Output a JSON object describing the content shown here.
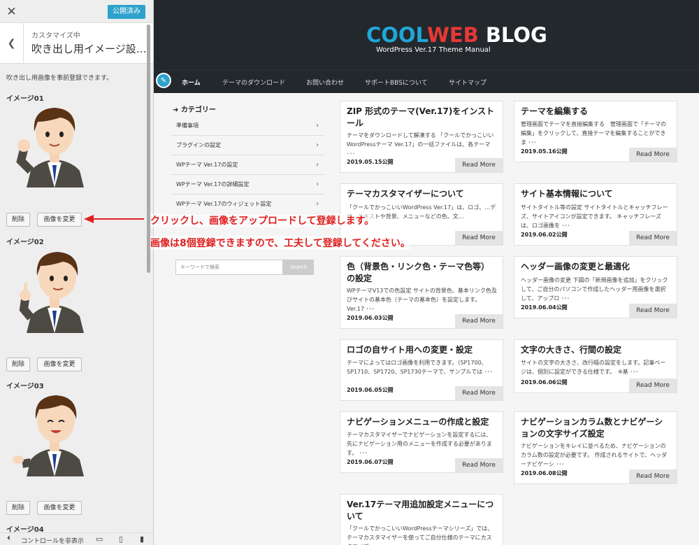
{
  "customizer": {
    "close_icon": "close-icon",
    "publish_label": "公開済み",
    "section_sub": "カスタマイズ中",
    "section_title": "吹き出し用イメージ設…",
    "description": "吹き出し用画像を事前登録できます。",
    "images": [
      {
        "label": "イメージ01",
        "delete": "削除",
        "change": "画像を変更"
      },
      {
        "label": "イメージ02",
        "delete": "削除",
        "change": "画像を変更"
      },
      {
        "label": "イメージ03",
        "delete": "削除",
        "change": "画像を変更"
      },
      {
        "label": "イメージ04"
      }
    ],
    "footer_label": "コントロールを非表示"
  },
  "site": {
    "logo_parts": [
      "COOL",
      "WEB",
      " BLOG"
    ],
    "tagline": "WordPress Ver.17 Theme Manual",
    "nav": [
      "ホーム",
      "テーマのダウンロード",
      "お問い合わせ",
      "サポートBBSについて",
      "サイトマップ"
    ],
    "category_title": "カテゴリー",
    "categories": [
      "準備事項",
      "プラグインの設定",
      "WPテーマ Ver.17の設定",
      "WPテーマ Ver.17の詳細設定",
      "WPテーマ Ver.17のウィジェット設定"
    ],
    "search_placeholder": "キーワードで検索",
    "search_button": "Search",
    "read_more": "Read More",
    "posts_left": [
      {
        "title": "ZIP 形式のテーマ(Ver.17)をインストール",
        "text": "テーマをダウンロードして解凍する 「クールでかっこいいWordPressテーマ Ver.17」の一括ファイルは、各テーマ ･･･",
        "date": "2019.05.15公開"
      },
      {
        "title": "テーマカスタマイザーについて",
        "text": "「クールでかっこいいWordPress Ver.17」は、ロゴ、…デザ…テキストや背景、メニューなどの色、文…",
        "date": ""
      },
      {
        "title": "色（背景色・リンク色・テーマ色等）の設定",
        "text": "WPテーマV13での色設定 サイトの背景色、基本リンク色及びサイトの基本色（テーマの基本色）を設定します。 Ver.17 ･･･",
        "date": "2019.06.03公開"
      },
      {
        "title": "ロゴの自サイト用への変更・設定",
        "text": "テーマによってはロゴ画像を利用できます。（SP1700、SP1710、SP1720、SP1730テーマで、サンプルでは ･･･",
        "date": "2019.06.05公開"
      },
      {
        "title": "ナビゲーションメニューの作成と設定",
        "text": "テーマカスタマイザーでナビゲーションを設定するには、先にナビゲーション用のメニューを作成する必要があります。 ･･･",
        "date": "2019.06.07公開"
      },
      {
        "title": "Ver.17テーマ用追加設定メニューについて",
        "text": "「クールでかっこいいWordPressテーマシリーズ」では、テーマカスタマイザーを使ってご自分仕様のテーマにカスタマイズ…",
        "date": ""
      }
    ],
    "posts_right": [
      {
        "title": "テーマを編集する",
        "text": "管理画面でテーマを直接編集する　管理画面で「テーマの編集」をクリックして、直接テーマを編集することができま ･･･",
        "date": "2019.05.16公開"
      },
      {
        "title": "サイト基本情報について",
        "text": "サイトタイトル等の設定 サイトタイトルとキャッチフレーズ、サイトアイコンが設定できます。 キャッチフレーズは、ロゴ画像を ･･･",
        "date": "2019.06.02公開"
      },
      {
        "title": "ヘッダー画像の変更と最適化",
        "text": "ヘッダー画像の変更 下図の「新規画像を追加」をクリックして、ご自分のパソコンで作成したヘッダー用画像を選択して、アップロ ･･･",
        "date": "2019.06.04公開"
      },
      {
        "title": "文字の大きさ、行間の設定",
        "text": "サイトの文字の大きさ、改行幅の設定をします。記事ページは、個別に設定ができる仕様です。　※基 ･･･",
        "date": "2019.06.06公開"
      },
      {
        "title": "ナビゲーションカラム数とナビゲーションの文字サイズ設定",
        "text": "ナビゲーションをキレイに並べるため、ナビゲーションのカラム数の設定が必要です。 作成されるサイトで、ヘッダーナビゲーシ ･･･",
        "date": "2019.06.08公開"
      }
    ]
  },
  "annotation": {
    "line1": "クリックし、画像をアップロードして登録します。",
    "line2": "画像は8個登録できますので、工夫して登録してください。",
    "color": "#e02020"
  }
}
